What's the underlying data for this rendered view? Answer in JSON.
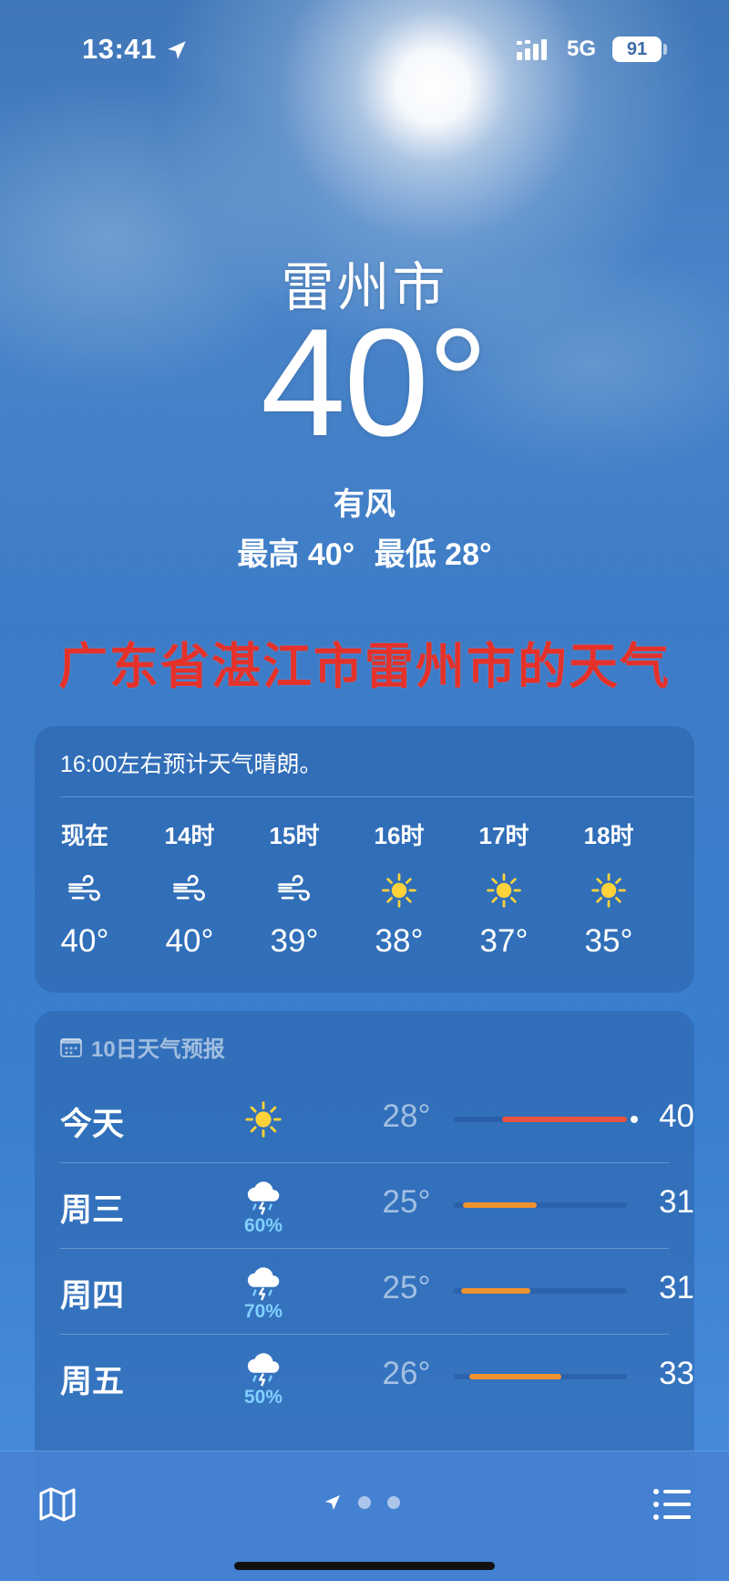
{
  "status_bar": {
    "time": "13:41",
    "network": "5G",
    "battery": "91"
  },
  "header": {
    "city": "雷州市",
    "temperature": "40°",
    "condition": "有风",
    "high": "最高 40°",
    "low": "最低 28°"
  },
  "caption": "广东省湛江市雷州市的天气",
  "hourly": {
    "summary": "16:00左右预计天气晴朗。",
    "items": [
      {
        "label": "现在",
        "icon": "wind-icon",
        "temp": "40°"
      },
      {
        "label": "14时",
        "icon": "wind-icon",
        "temp": "40°"
      },
      {
        "label": "15时",
        "icon": "wind-icon",
        "temp": "39°"
      },
      {
        "label": "16时",
        "icon": "sun-icon",
        "temp": "38°"
      },
      {
        "label": "17时",
        "icon": "sun-icon",
        "temp": "37°"
      },
      {
        "label": "18时",
        "icon": "sun-icon",
        "temp": "35°"
      }
    ]
  },
  "daily": {
    "title": "10日天气预报",
    "days": [
      {
        "day": "今天",
        "icon": "sun-icon",
        "precip": "",
        "low": "28°",
        "high": "40°",
        "range_start": 0.28,
        "range_end": 1.0,
        "color": "#e8553f",
        "current_marker": true
      },
      {
        "day": "周三",
        "icon": "thunderstorm-icon",
        "precip": "60%",
        "low": "25°",
        "high": "31°",
        "range_start": 0.05,
        "range_end": 0.48,
        "color": "#f0932e",
        "current_marker": false
      },
      {
        "day": "周四",
        "icon": "thunderstorm-icon",
        "precip": "70%",
        "low": "25°",
        "high": "31°",
        "range_start": 0.04,
        "range_end": 0.44,
        "color": "#f0932e",
        "current_marker": false
      },
      {
        "day": "周五",
        "icon": "thunderstorm-icon",
        "precip": "50%",
        "low": "26°",
        "high": "33°",
        "range_start": 0.09,
        "range_end": 0.62,
        "color": "#f0932e",
        "current_marker": false
      }
    ]
  },
  "colors": {
    "accent_red": "#e4322b",
    "range_orange": "#f0932e",
    "range_red": "#e8553f",
    "precip_blue": "#7fd0ff"
  }
}
